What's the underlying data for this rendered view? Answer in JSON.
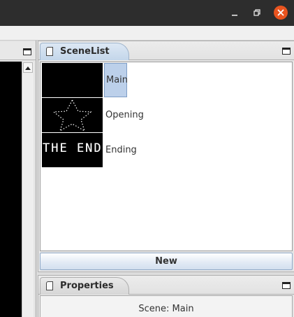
{
  "window": {
    "controls": [
      "minimize-icon",
      "maximize-icon",
      "close-icon"
    ],
    "colors": {
      "titlebar": "#2d2d2d",
      "close": "#e9541f"
    }
  },
  "scene_list": {
    "title": "SceneList",
    "scenes": [
      {
        "label": "Main",
        "selected": true,
        "thumbnail": "blank"
      },
      {
        "label": "Opening",
        "selected": false,
        "thumbnail": "star-outline"
      },
      {
        "label": "Ending",
        "selected": false,
        "thumbnail_text": "THE END"
      }
    ],
    "new_button": "New"
  },
  "properties": {
    "title": "Properties",
    "scene_text": "Scene: Main"
  },
  "colors": {
    "selection": "#bcd0ea",
    "tab_active": "#c3d6ea",
    "canvas": "#000000"
  }
}
